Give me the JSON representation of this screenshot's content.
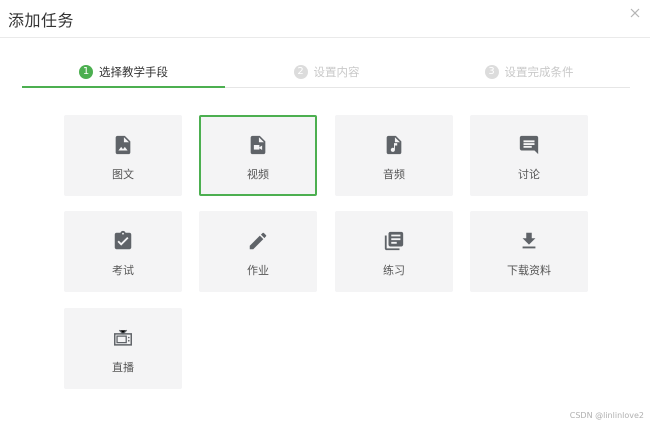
{
  "dialog": {
    "title": "添加任务",
    "close_icon": "close-icon"
  },
  "steps": [
    {
      "number": "1",
      "label": "选择教学手段",
      "state": "active"
    },
    {
      "number": "2",
      "label": "设置内容",
      "state": "inactive"
    },
    {
      "number": "3",
      "label": "设置完成条件",
      "state": "inactive"
    }
  ],
  "options": [
    {
      "label": "图文",
      "icon": "image-file-icon",
      "selected": false
    },
    {
      "label": "视频",
      "icon": "video-file-icon",
      "selected": true
    },
    {
      "label": "音频",
      "icon": "audio-file-icon",
      "selected": false
    },
    {
      "label": "讨论",
      "icon": "comment-icon",
      "selected": false
    },
    {
      "label": "考试",
      "icon": "clipboard-check-icon",
      "selected": false
    },
    {
      "label": "作业",
      "icon": "pencil-icon",
      "selected": false
    },
    {
      "label": "练习",
      "icon": "library-books-icon",
      "selected": false
    },
    {
      "label": "下载资料",
      "icon": "download-icon",
      "selected": false
    },
    {
      "label": "直播",
      "icon": "tv-icon",
      "selected": false
    }
  ],
  "watermark": "CSDN @linlinlove2",
  "colors": {
    "accent": "#4caf50",
    "card_bg": "#f4f4f5",
    "icon": "#5f6368"
  }
}
